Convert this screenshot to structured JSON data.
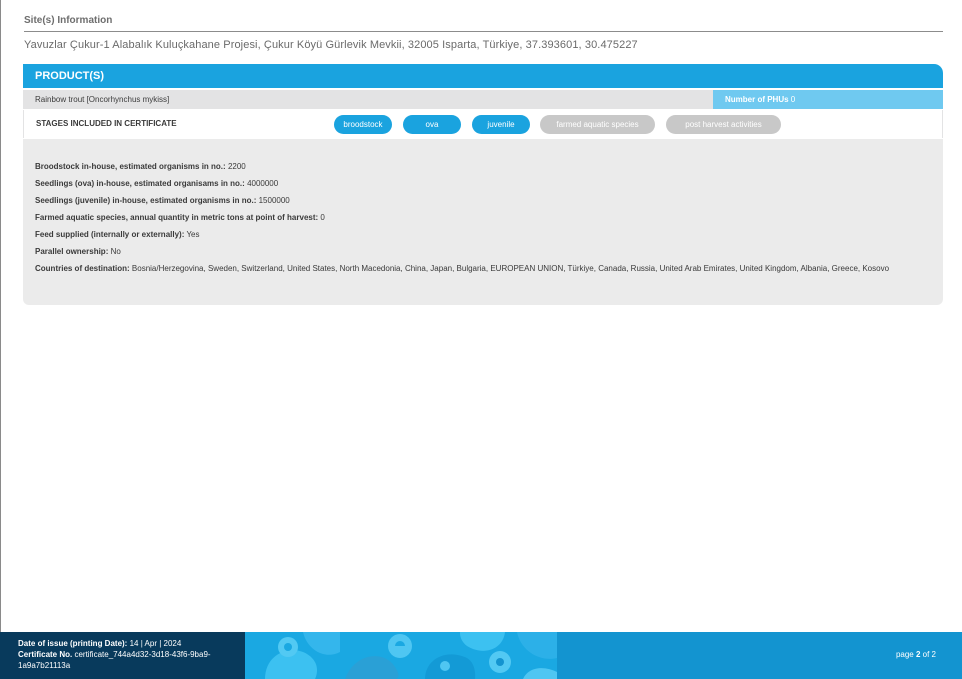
{
  "site": {
    "heading": "Site(s) Information",
    "address": "Yavuzlar Çukur-1 Alabalık Kuluçkahane Projesi, Çukur Köyü Gürlevik Mevkii, 32005 Isparta, Türkiye, 37.393601, 30.475227"
  },
  "product": {
    "header": "PRODUCT(S)",
    "species": "Rainbow trout [Oncorhynchus mykiss]",
    "phu_label": "Number of PHUs",
    "phu_value": "0",
    "stages_label": "STAGES INCLUDED IN CERTIFICATE",
    "stages": [
      {
        "label": "broodstock",
        "active": true
      },
      {
        "label": "ova",
        "active": true
      },
      {
        "label": "juvenile",
        "active": true
      },
      {
        "label": "farmed aquatic species",
        "active": false
      },
      {
        "label": "post harvest activities",
        "active": false
      }
    ],
    "details": [
      {
        "key": "Broodstock in-house, estimated organisms in no.:",
        "value": "2200"
      },
      {
        "key": "Seedlings (ova) in-house, estimated organisams in no.:",
        "value": "4000000"
      },
      {
        "key": "Seedlings (juvenile) in-house, estimated organisms in no.:",
        "value": "1500000"
      },
      {
        "key": "Farmed aquatic species, annual quantity in metric tons at point of harvest:",
        "value": "0"
      },
      {
        "key": "Feed supplied (internally or externally):",
        "value": "Yes"
      },
      {
        "key": "Parallel ownership:",
        "value": "No"
      },
      {
        "key": "Countries of destination:",
        "value": "Bosnia/Herzegovina, Sweden, Switzerland, United States, North Macedonia, China, Japan, Bulgaria, EUROPEAN UNION, Türkiye, Canada, Russia, United Arab Emirates, United Kingdom, Albania, Greece, Kosovo"
      }
    ]
  },
  "footer": {
    "date_label": "Date of issue (printing Date):",
    "date_value": "14 | Apr | 2024",
    "cert_label": "Certificate No.",
    "cert_value": "certificate_744a4d32-3d18-43f6-9ba9-1a9a7b21113a",
    "page_word": "page",
    "page_current": "2",
    "page_of": "of 2"
  },
  "colors": {
    "accent_blue": "#1aa3df",
    "light_blue": "#6fc9f0",
    "navy": "#083a5c",
    "inactive_grey": "#c8c8c8"
  }
}
